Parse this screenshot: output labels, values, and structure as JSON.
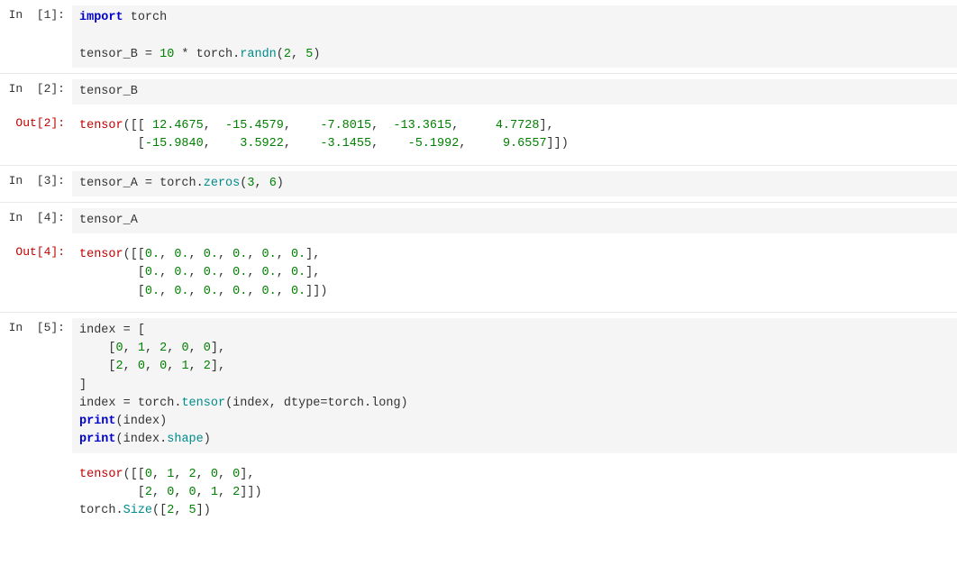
{
  "cells": [
    {
      "id": "cell1",
      "in_label": "In",
      "in_num": "[1]:",
      "type": "input",
      "code_html": "<span class='kw'>import</span> <span class='var2'>torch</span>\n\n<span class='var2'>tensor_B</span> = <span class='num'>10</span> * <span class='var2'>torch</span>.<span class='fn'>randn</span>(<span class='num'>2</span>, <span class='num'>5</span>)"
    },
    {
      "id": "cell2",
      "in_label": "In",
      "in_num": "[2]:",
      "type": "input",
      "code_html": "<span class='var2'>tensor_B</span>"
    },
    {
      "id": "cell2out",
      "out_label": "Out[2]:",
      "type": "output",
      "output_html": "<span class='outred'>tensor</span>([[ <span class='outnum'>12.4675</span>,  <span class='outnum'>-15.4579</span>,   <span class='outnum'>-7.8015</span>,  <span class='outnum'>-13.3615</span>,    <span class='outnum'>4.7728</span>],\n        [<span class='outnum'>-15.9840</span>,    <span class='outnum'>3.5922</span>,   <span class='outnum'>-3.1455</span>,   <span class='outnum'>-5.1992</span>,    <span class='outnum'>9.6557</span>]])"
    },
    {
      "id": "cell3",
      "in_label": "In",
      "in_num": "[3]:",
      "type": "input",
      "code_html": "<span class='var2'>tensor_A</span> = <span class='var2'>torch</span>.<span class='fn'>zeros</span>(<span class='num'>3</span>, <span class='num'>6</span>)"
    },
    {
      "id": "cell4",
      "in_label": "In",
      "in_num": "[4]:",
      "type": "input",
      "code_html": "<span class='var2'>tensor_A</span>"
    },
    {
      "id": "cell4out",
      "out_label": "Out[4]:",
      "type": "output",
      "output_html": "<span class='outred'>tensor</span>([[<span class='outnum'>0.</span>, <span class='outnum'>0.</span>, <span class='outnum'>0.</span>, <span class='outnum'>0.</span>, <span class='outnum'>0.</span>, <span class='outnum'>0.</span>],\n        [<span class='outnum'>0.</span>, <span class='outnum'>0.</span>, <span class='outnum'>0.</span>, <span class='outnum'>0.</span>, <span class='outnum'>0.</span>, <span class='outnum'>0.</span>],\n        [<span class='outnum'>0.</span>, <span class='outnum'>0.</span>, <span class='outnum'>0.</span>, <span class='outnum'>0.</span>, <span class='outnum'>0.</span>, <span class='outnum'>0.</span>]])"
    },
    {
      "id": "cell5",
      "in_label": "In",
      "in_num": "[5]:",
      "type": "input",
      "code_html": "<span class='var2'>index</span> = [\n    [<span class='num'>0</span>, <span class='num'>1</span>, <span class='num'>2</span>, <span class='num'>0</span>, <span class='num'>0</span>],\n    [<span class='num'>2</span>, <span class='num'>0</span>, <span class='num'>0</span>, <span class='num'>1</span>, <span class='num'>2</span>],\n]\n<span class='var2'>index</span> = <span class='var2'>torch</span>.<span class='fn'>tensor</span>(<span class='var2'>index</span>, <span class='var2'>dtype</span>=<span class='var2'>torch</span>.<span class='var2'>long</span>)\n<span class='kw'>print</span>(<span class='var2'>index</span>)\n<span class='kw'>print</span>(<span class='var2'>index</span>.<span class='fn'>shape</span>)"
    },
    {
      "id": "cell5out",
      "out_label": "",
      "type": "output",
      "output_html": "<span class='outred'>tensor</span>([[<span class='outnum'>0</span>, <span class='outnum'>1</span>, <span class='outnum'>2</span>, <span class='outnum'>0</span>, <span class='outnum'>0</span>],\n        [<span class='outnum'>2</span>, <span class='outnum'>0</span>, <span class='outnum'>0</span>, <span class='outnum'>1</span>, <span class='outnum'>2</span>]])\n<span class='var2'>torch</span>.<span class='fn'>Size</span>([<span class='outnum'>2</span>, <span class='outnum'>5</span>])"
    }
  ]
}
